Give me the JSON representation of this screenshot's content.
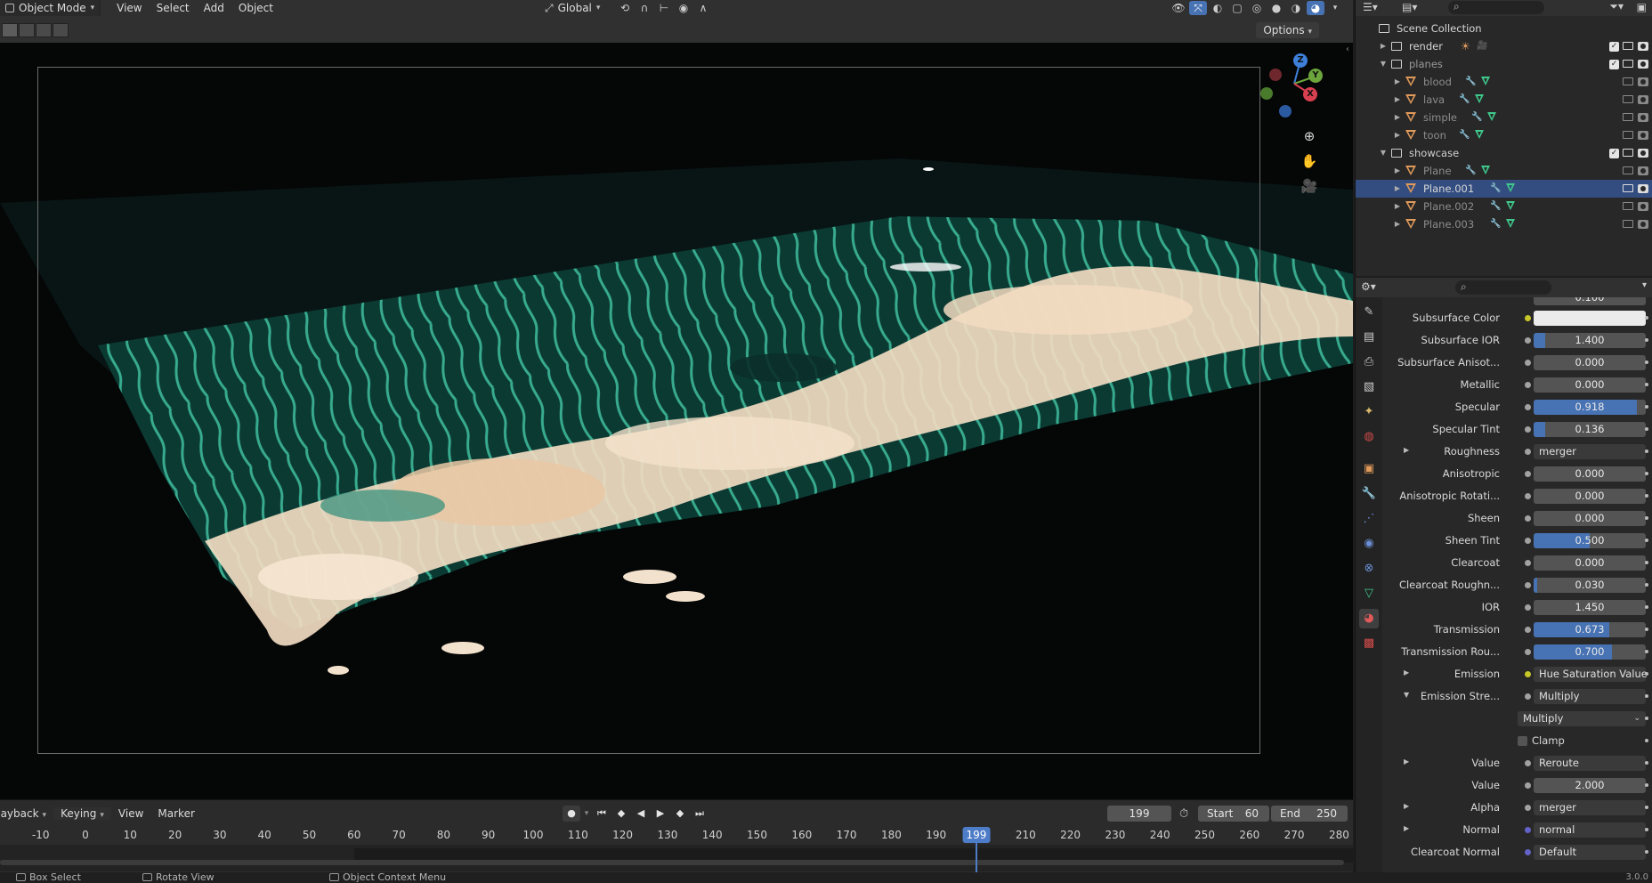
{
  "header": {
    "mode": "Object Mode",
    "menus": [
      "View",
      "Select",
      "Add",
      "Object"
    ],
    "orientation": "Global",
    "options_label": "Options"
  },
  "viewport": {
    "gizmo": {
      "x": "X",
      "y": "Y",
      "z": "Z"
    }
  },
  "timeline": {
    "menus": {
      "playback": "Playback",
      "keying": "Keying",
      "view": "View",
      "marker": "Marker"
    },
    "current_frame": "199",
    "start_label": "Start",
    "start_value": "60",
    "end_label": "End",
    "end_value": "250",
    "ticks": [
      "-10",
      "0",
      "10",
      "20",
      "30",
      "40",
      "50",
      "60",
      "70",
      "80",
      "90",
      "100",
      "110",
      "120",
      "130",
      "140",
      "150",
      "160",
      "170",
      "180",
      "190",
      "210",
      "220",
      "230",
      "240",
      "250",
      "260",
      "270",
      "280"
    ]
  },
  "statusbar": {
    "box_select": "Box Select",
    "rotate_view": "Rotate View",
    "context_menu": "Object Context Menu",
    "version": "3.0.0"
  },
  "outliner": {
    "root": "Scene Collection",
    "rows": [
      {
        "label": "render",
        "type": "collection",
        "checked": true
      },
      {
        "label": "planes",
        "type": "collection",
        "checked": true
      },
      {
        "label": "blood",
        "type": "object"
      },
      {
        "label": "lava",
        "type": "object"
      },
      {
        "label": "simple",
        "type": "object"
      },
      {
        "label": "toon",
        "type": "object"
      },
      {
        "label": "showcase",
        "type": "collection",
        "checked": true
      },
      {
        "label": "Plane",
        "type": "object"
      },
      {
        "label": "Plane.001",
        "type": "object",
        "selected": true
      },
      {
        "label": "Plane.002",
        "type": "object"
      },
      {
        "label": "Plane.003",
        "type": "object"
      }
    ]
  },
  "properties": {
    "partial_top_value": "0.100",
    "rows": [
      {
        "label": "Subsurface Color",
        "kind": "color",
        "socket": "yellow"
      },
      {
        "label": "Subsurface IOR",
        "kind": "number",
        "value": "1.400",
        "fill": 0.1
      },
      {
        "label": "Subsurface Anisot...",
        "kind": "number",
        "value": "0.000",
        "fill": 0
      },
      {
        "label": "Metallic",
        "kind": "number",
        "value": "0.000",
        "fill": 0
      },
      {
        "label": "Specular",
        "kind": "number",
        "value": "0.918",
        "fill": 0.918
      },
      {
        "label": "Specular Tint",
        "kind": "number",
        "value": "0.136",
        "fill": 0.1
      },
      {
        "label": "Roughness",
        "kind": "link",
        "value": "merger",
        "expander": true
      },
      {
        "label": "Anisotropic",
        "kind": "number",
        "value": "0.000",
        "fill": 0
      },
      {
        "label": "Anisotropic Rotati...",
        "kind": "number",
        "value": "0.000",
        "fill": 0
      },
      {
        "label": "Sheen",
        "kind": "number",
        "value": "0.000",
        "fill": 0
      },
      {
        "label": "Sheen Tint",
        "kind": "number",
        "value": "0.500",
        "fill": 0.5
      },
      {
        "label": "Clearcoat",
        "kind": "number",
        "value": "0.000",
        "fill": 0
      },
      {
        "label": "Clearcoat Roughn...",
        "kind": "number",
        "value": "0.030",
        "fill": 0.03
      },
      {
        "label": "IOR",
        "kind": "number",
        "value": "1.450",
        "fill": 0
      },
      {
        "label": "Transmission",
        "kind": "number",
        "value": "0.673",
        "fill": 0.673
      },
      {
        "label": "Transmission Rou...",
        "kind": "number",
        "value": "0.700",
        "fill": 0.7
      },
      {
        "label": "Emission",
        "kind": "link",
        "value": "Hue Saturation Value",
        "expander": true,
        "socket": "yellow"
      },
      {
        "label": "Emission Stre...",
        "kind": "link",
        "value": "Multiply",
        "expander": true,
        "expanded": true
      },
      {
        "label": "",
        "kind": "dropdown",
        "value": "Multiply"
      },
      {
        "label": "",
        "kind": "checkbox",
        "value": "Clamp"
      },
      {
        "label": "Value",
        "kind": "link",
        "value": "Reroute",
        "expander": true
      },
      {
        "label": "Value",
        "kind": "number",
        "value": "2.000",
        "fill": 0
      },
      {
        "label": "Alpha",
        "kind": "link",
        "value": "merger",
        "expander": true
      },
      {
        "label": "Normal",
        "kind": "link",
        "value": "normal",
        "expander": true,
        "socket": "violet"
      },
      {
        "label": "Clearcoat Normal",
        "kind": "link",
        "value": "Default",
        "socket": "violet"
      }
    ]
  },
  "colors": {
    "accent": "#4772b3",
    "water_teal": "#1f8a77",
    "foam": "#f2d9bf",
    "mesh_orange": "#e09a5a",
    "modifier_blue": "#6b8fd6",
    "mesh_green": "#3fc98c"
  }
}
